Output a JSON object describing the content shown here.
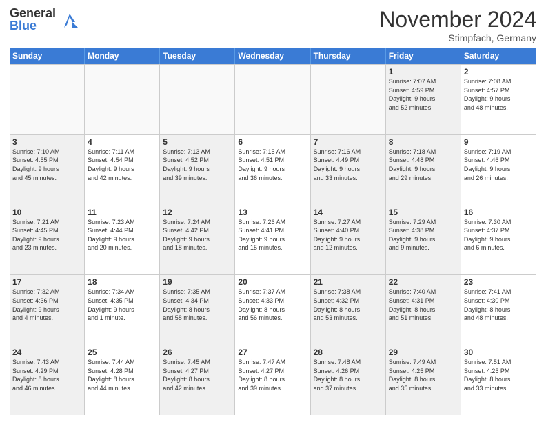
{
  "header": {
    "logo_general": "General",
    "logo_blue": "Blue",
    "month_title": "November 2024",
    "subtitle": "Stimpfach, Germany"
  },
  "weekdays": [
    "Sunday",
    "Monday",
    "Tuesday",
    "Wednesday",
    "Thursday",
    "Friday",
    "Saturday"
  ],
  "rows": [
    [
      {
        "day": "",
        "info": "",
        "empty": true
      },
      {
        "day": "",
        "info": "",
        "empty": true
      },
      {
        "day": "",
        "info": "",
        "empty": true
      },
      {
        "day": "",
        "info": "",
        "empty": true
      },
      {
        "day": "",
        "info": "",
        "empty": true
      },
      {
        "day": "1",
        "info": "Sunrise: 7:07 AM\nSunset: 4:59 PM\nDaylight: 9 hours\nand 52 minutes.",
        "shaded": true
      },
      {
        "day": "2",
        "info": "Sunrise: 7:08 AM\nSunset: 4:57 PM\nDaylight: 9 hours\nand 48 minutes."
      }
    ],
    [
      {
        "day": "3",
        "info": "Sunrise: 7:10 AM\nSunset: 4:55 PM\nDaylight: 9 hours\nand 45 minutes.",
        "shaded": true
      },
      {
        "day": "4",
        "info": "Sunrise: 7:11 AM\nSunset: 4:54 PM\nDaylight: 9 hours\nand 42 minutes."
      },
      {
        "day": "5",
        "info": "Sunrise: 7:13 AM\nSunset: 4:52 PM\nDaylight: 9 hours\nand 39 minutes.",
        "shaded": true
      },
      {
        "day": "6",
        "info": "Sunrise: 7:15 AM\nSunset: 4:51 PM\nDaylight: 9 hours\nand 36 minutes."
      },
      {
        "day": "7",
        "info": "Sunrise: 7:16 AM\nSunset: 4:49 PM\nDaylight: 9 hours\nand 33 minutes.",
        "shaded": true
      },
      {
        "day": "8",
        "info": "Sunrise: 7:18 AM\nSunset: 4:48 PM\nDaylight: 9 hours\nand 29 minutes.",
        "shaded": true
      },
      {
        "day": "9",
        "info": "Sunrise: 7:19 AM\nSunset: 4:46 PM\nDaylight: 9 hours\nand 26 minutes."
      }
    ],
    [
      {
        "day": "10",
        "info": "Sunrise: 7:21 AM\nSunset: 4:45 PM\nDaylight: 9 hours\nand 23 minutes.",
        "shaded": true
      },
      {
        "day": "11",
        "info": "Sunrise: 7:23 AM\nSunset: 4:44 PM\nDaylight: 9 hours\nand 20 minutes."
      },
      {
        "day": "12",
        "info": "Sunrise: 7:24 AM\nSunset: 4:42 PM\nDaylight: 9 hours\nand 18 minutes.",
        "shaded": true
      },
      {
        "day": "13",
        "info": "Sunrise: 7:26 AM\nSunset: 4:41 PM\nDaylight: 9 hours\nand 15 minutes."
      },
      {
        "day": "14",
        "info": "Sunrise: 7:27 AM\nSunset: 4:40 PM\nDaylight: 9 hours\nand 12 minutes.",
        "shaded": true
      },
      {
        "day": "15",
        "info": "Sunrise: 7:29 AM\nSunset: 4:38 PM\nDaylight: 9 hours\nand 9 minutes.",
        "shaded": true
      },
      {
        "day": "16",
        "info": "Sunrise: 7:30 AM\nSunset: 4:37 PM\nDaylight: 9 hours\nand 6 minutes."
      }
    ],
    [
      {
        "day": "17",
        "info": "Sunrise: 7:32 AM\nSunset: 4:36 PM\nDaylight: 9 hours\nand 4 minutes.",
        "shaded": true
      },
      {
        "day": "18",
        "info": "Sunrise: 7:34 AM\nSunset: 4:35 PM\nDaylight: 9 hours\nand 1 minute."
      },
      {
        "day": "19",
        "info": "Sunrise: 7:35 AM\nSunset: 4:34 PM\nDaylight: 8 hours\nand 58 minutes.",
        "shaded": true
      },
      {
        "day": "20",
        "info": "Sunrise: 7:37 AM\nSunset: 4:33 PM\nDaylight: 8 hours\nand 56 minutes."
      },
      {
        "day": "21",
        "info": "Sunrise: 7:38 AM\nSunset: 4:32 PM\nDaylight: 8 hours\nand 53 minutes.",
        "shaded": true
      },
      {
        "day": "22",
        "info": "Sunrise: 7:40 AM\nSunset: 4:31 PM\nDaylight: 8 hours\nand 51 minutes.",
        "shaded": true
      },
      {
        "day": "23",
        "info": "Sunrise: 7:41 AM\nSunset: 4:30 PM\nDaylight: 8 hours\nand 48 minutes."
      }
    ],
    [
      {
        "day": "24",
        "info": "Sunrise: 7:43 AM\nSunset: 4:29 PM\nDaylight: 8 hours\nand 46 minutes.",
        "shaded": true
      },
      {
        "day": "25",
        "info": "Sunrise: 7:44 AM\nSunset: 4:28 PM\nDaylight: 8 hours\nand 44 minutes."
      },
      {
        "day": "26",
        "info": "Sunrise: 7:45 AM\nSunset: 4:27 PM\nDaylight: 8 hours\nand 42 minutes.",
        "shaded": true
      },
      {
        "day": "27",
        "info": "Sunrise: 7:47 AM\nSunset: 4:27 PM\nDaylight: 8 hours\nand 39 minutes."
      },
      {
        "day": "28",
        "info": "Sunrise: 7:48 AM\nSunset: 4:26 PM\nDaylight: 8 hours\nand 37 minutes.",
        "shaded": true
      },
      {
        "day": "29",
        "info": "Sunrise: 7:49 AM\nSunset: 4:25 PM\nDaylight: 8 hours\nand 35 minutes.",
        "shaded": true
      },
      {
        "day": "30",
        "info": "Sunrise: 7:51 AM\nSunset: 4:25 PM\nDaylight: 8 hours\nand 33 minutes."
      }
    ]
  ]
}
